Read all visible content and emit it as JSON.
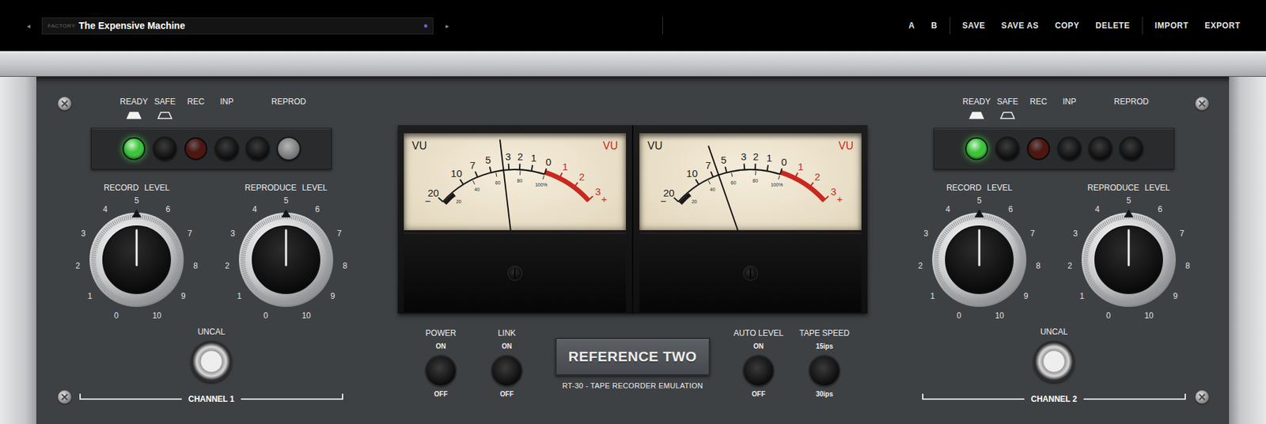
{
  "preset": {
    "prev": "◂",
    "next": "▸",
    "bank": "FACTORY",
    "name": "The Expensive Machine"
  },
  "toolbar": [
    [
      "A",
      "B"
    ],
    [
      "SAVE",
      "SAVE AS",
      "COPY",
      "DELETE"
    ],
    [
      "IMPORT",
      "EXPORT"
    ]
  ],
  "channels": [
    {
      "name": "CHANNEL 1",
      "transport": [
        {
          "label": "READY",
          "kind": "lamp",
          "marker": true,
          "on": true,
          "color": "#3cc43c"
        },
        {
          "label": "SAFE",
          "kind": "button",
          "marker": true,
          "on": false
        },
        {
          "label": "REC",
          "kind": "lamp",
          "marker": false,
          "on": false,
          "color": "#c42a1e"
        },
        {
          "label": "INP",
          "kind": "button",
          "marker": false,
          "on": false
        },
        {
          "label": "",
          "kind": "button",
          "marker": false,
          "on": false
        },
        {
          "label": "REPROD",
          "kind": "button",
          "marker": false,
          "on": true
        }
      ],
      "knobs": [
        {
          "label": "RECORD LEVEL",
          "level": 0.5
        },
        {
          "label": "REPRODUCE LEVEL",
          "level": 0.5
        }
      ],
      "uncal": "UNCAL"
    },
    {
      "name": "CHANNEL 2",
      "transport": [
        {
          "label": "READY",
          "kind": "lamp",
          "marker": true,
          "on": true,
          "color": "#3cc43c"
        },
        {
          "label": "SAFE",
          "kind": "button",
          "marker": true,
          "on": false
        },
        {
          "label": "REC",
          "kind": "lamp",
          "marker": false,
          "on": false,
          "color": "#c42a1e"
        },
        {
          "label": "INP",
          "kind": "button",
          "marker": false,
          "on": false
        },
        {
          "label": "",
          "kind": "button",
          "marker": false,
          "on": false
        },
        {
          "label": "REPROD",
          "kind": "button",
          "marker": false,
          "on": false
        }
      ],
      "knobs": [
        {
          "label": "RECORD LEVEL",
          "level": 0.5
        },
        {
          "label": "REPRODUCE LEVEL",
          "level": 0.5
        }
      ],
      "uncal": "UNCAL"
    }
  ],
  "knob_scale": [
    "0",
    "1",
    "2",
    "3",
    "4",
    "5",
    "6",
    "7",
    "8",
    "9",
    "10"
  ],
  "meters": [
    {
      "level": 0.43
    },
    {
      "level": 0.3
    }
  ],
  "vu_scale": {
    "left": "VU",
    "right": "VU",
    "minus": "−",
    "plus": "+",
    "black": [
      "20",
      "10",
      "7",
      "5",
      "3",
      "2",
      "1",
      "0"
    ],
    "red": [
      "1",
      "2",
      "3"
    ],
    "percent": [
      "20",
      "40",
      "60",
      "80",
      "100%"
    ]
  },
  "controls": {
    "left": [
      {
        "label": "POWER",
        "top": "ON",
        "bottom": "OFF"
      },
      {
        "label": "LINK",
        "top": "ON",
        "bottom": "OFF"
      }
    ],
    "right": [
      {
        "label": "AUTO LEVEL",
        "top": "ON",
        "bottom": "OFF"
      },
      {
        "label": "TAPE SPEED",
        "top": "15ips",
        "bottom": "30ips"
      }
    ]
  },
  "badge": {
    "title": "REFERENCE TWO",
    "subtitle": "RT-30 - TAPE RECORDER EMULATION"
  }
}
